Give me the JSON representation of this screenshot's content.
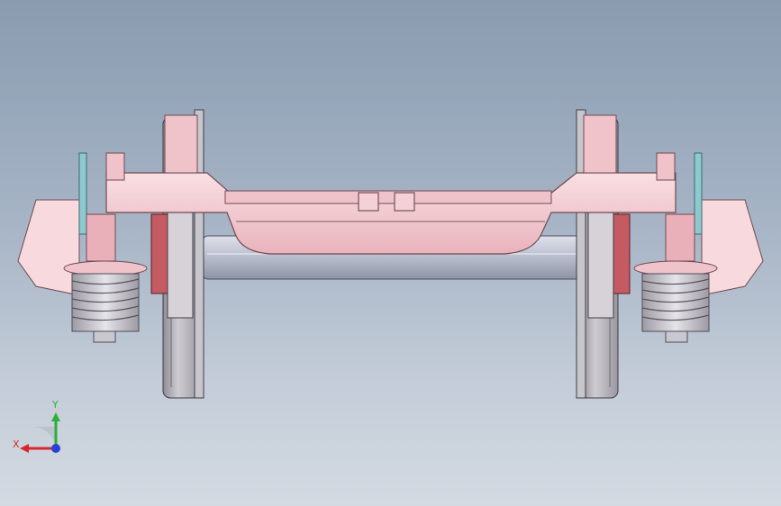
{
  "viewport": {
    "background_top": "#8a9bb0",
    "background_bottom": "#d3dae2"
  },
  "model": {
    "frame_color": "#f3c4cc",
    "frame_edge": "#6e4a52",
    "wheel_color": "#bfbcc2",
    "axle_color": "#b8bccb",
    "spring_color": "#c9c7cf",
    "bearing_color": "#c45a62",
    "bracket_color": "#8fc9cf"
  },
  "triad": {
    "x_label": "X",
    "y_label": "Y",
    "x_color": "#d9262c",
    "y_color": "#2fae3b",
    "z_color": "#2a3fd6"
  }
}
